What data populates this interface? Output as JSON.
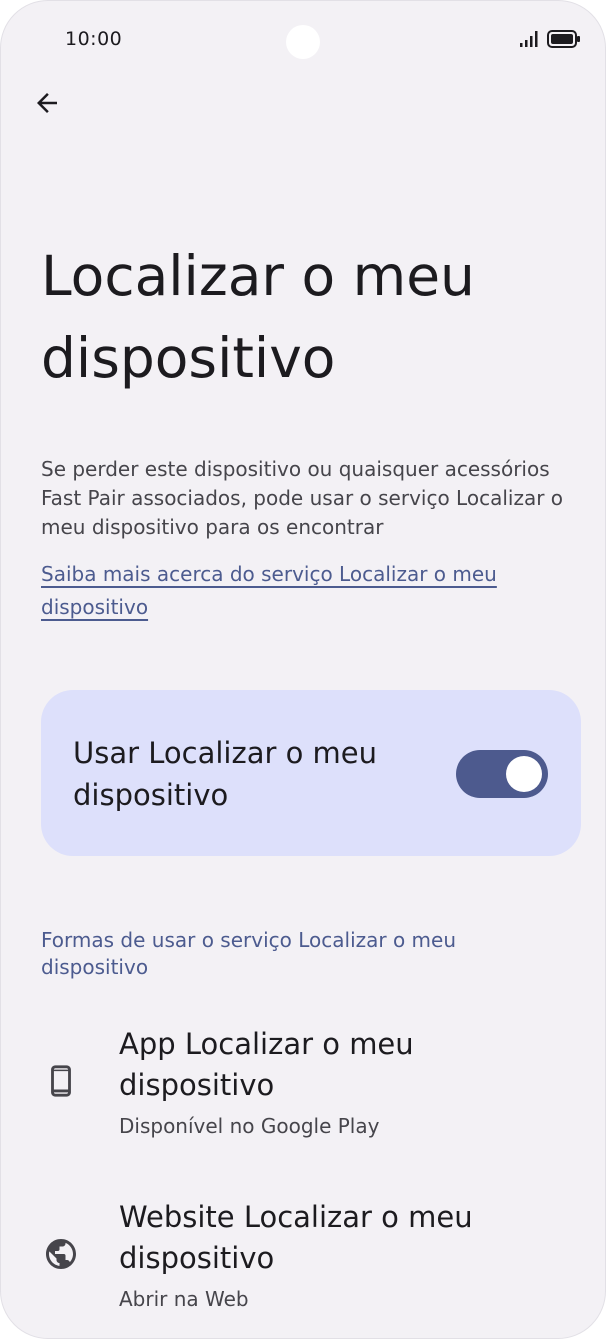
{
  "status_bar": {
    "time": "10:00",
    "icons": [
      "signal-icon",
      "battery-icon"
    ]
  },
  "header": {
    "back_icon": "arrow-back-icon",
    "title": "Localizar o meu dispositivo"
  },
  "main": {
    "description": "Se perder este dispositivo ou quaisquer acessórios Fast Pair associados, pode usar o serviço Localizar o meu dispositivo para os encontrar",
    "learn_more_link": "Saiba mais acerca do serviço Localizar o meu dispositivo",
    "toggle": {
      "label": "Usar Localizar o meu dispositivo",
      "checked": true
    },
    "section_header": "Formas de usar o serviço Localizar o meu dispositivo",
    "items": [
      {
        "icon": "phone-icon",
        "title": "App Localizar o meu dispositivo",
        "subtitle": "Disponível no Google Play"
      },
      {
        "icon": "globe-icon",
        "title": "Website Localizar o meu dispositivo",
        "subtitle": "Abrir na Web"
      }
    ]
  },
  "colors": {
    "background": "#f3f1f5",
    "accent": "#4c5b8f",
    "card": "#dde0fb",
    "switch_track": "#4d5a8e"
  }
}
